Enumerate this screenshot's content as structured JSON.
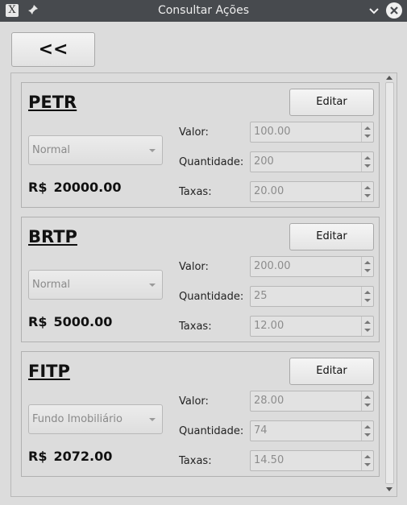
{
  "window": {
    "title": "Consultar Ações",
    "app_icon": "X",
    "pin_icon": "pin-icon",
    "minimize_icon": "chevron-down-icon",
    "close_icon": "close-icon"
  },
  "back_button": {
    "label": "<<"
  },
  "stocks": [
    {
      "ticker": "PETR",
      "edit_label": "Editar",
      "type": "Normal",
      "currency": "R$",
      "total": "20000.00",
      "valor_label": "Valor:",
      "valor": "100.00",
      "quantidade_label": "Quantidade:",
      "quantidade": "200",
      "taxas_label": "Taxas:",
      "taxas": "20.00"
    },
    {
      "ticker": "BRTP",
      "edit_label": "Editar",
      "type": "Normal",
      "currency": "R$",
      "total": "5000.00",
      "valor_label": "Valor:",
      "valor": "200.00",
      "quantidade_label": "Quantidade:",
      "quantidade": "25",
      "taxas_label": "Taxas:",
      "taxas": "12.00"
    },
    {
      "ticker": "FITP",
      "edit_label": "Editar",
      "type": "Fundo Imobiliário",
      "currency": "R$",
      "total": "2072.00",
      "valor_label": "Valor:",
      "valor": "28.00",
      "quantidade_label": "Quantidade:",
      "quantidade": "74",
      "taxas_label": "Taxas:",
      "taxas": "14.50"
    }
  ]
}
